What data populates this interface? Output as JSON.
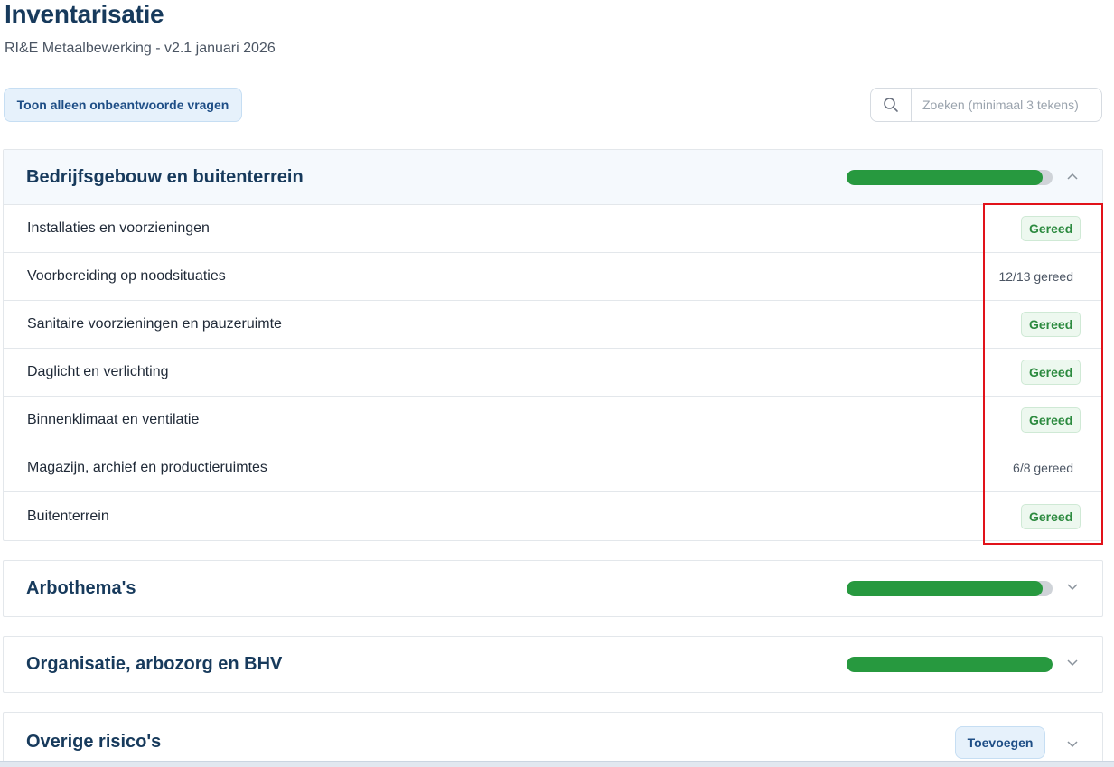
{
  "header": {
    "title": "Inventarisatie",
    "subtitle": "RI&E Metaalbewerking - v2.1 januari 2026"
  },
  "toolbar": {
    "filter_label": "Toon alleen onbeantwoorde vragen",
    "search_placeholder": "Zoeken (minimaal 3 tekens)",
    "search_value": ""
  },
  "colors": {
    "primary_text": "#173a5c",
    "progress_fill": "#27993f",
    "progress_track": "#cfd3d8",
    "badge_green": "#2c8a3f",
    "highlight": "#e1121a"
  },
  "sections": [
    {
      "title": "Bedrijfsgebouw en buitenterrein",
      "expanded": true,
      "progress_percent": 95,
      "items": [
        {
          "label": "Installaties en voorzieningen",
          "status": "Gereed",
          "status_type": "badge"
        },
        {
          "label": "Voorbereiding op noodsituaties",
          "status": "12/13 gereed",
          "status_type": "text"
        },
        {
          "label": "Sanitaire voorzieningen en pauzeruimte",
          "status": "Gereed",
          "status_type": "badge"
        },
        {
          "label": "Daglicht en verlichting",
          "status": "Gereed",
          "status_type": "badge"
        },
        {
          "label": "Binnenklimaat en ventilatie",
          "status": "Gereed",
          "status_type": "badge"
        },
        {
          "label": "Magazijn, archief en productieruimtes",
          "status": "6/8 gereed",
          "status_type": "text"
        },
        {
          "label": "Buitenterrein",
          "status": "Gereed",
          "status_type": "badge"
        }
      ]
    },
    {
      "title": "Arbothema's",
      "expanded": false,
      "progress_percent": 95
    },
    {
      "title": "Organisatie, arbozorg en BHV",
      "expanded": false,
      "progress_percent": 100
    },
    {
      "title": "Overige risico's",
      "expanded": false,
      "add_label": "Toevoegen"
    }
  ]
}
